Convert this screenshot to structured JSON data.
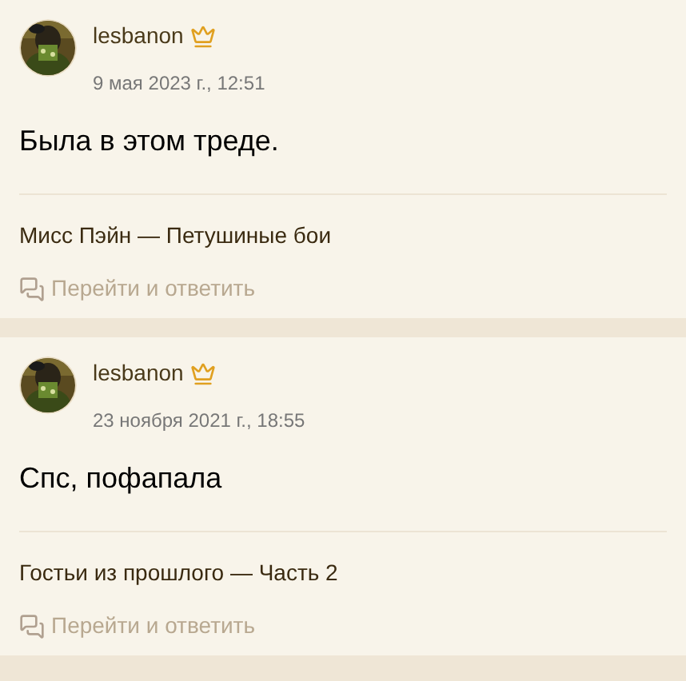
{
  "posts": [
    {
      "author": "lesbanon",
      "date": "9 мая 2023 г., 12:51",
      "message": "Была в этом треде.",
      "topic": "Мисс Пэйн — Петушиные бои",
      "reply": "Перейти и ответить"
    },
    {
      "author": "lesbanon",
      "date": "23 ноября 2021 г., 18:55",
      "message": "Спс, пофапала",
      "topic": "Гостьи из прошлого — Часть 2",
      "reply": "Перейти и ответить"
    }
  ]
}
